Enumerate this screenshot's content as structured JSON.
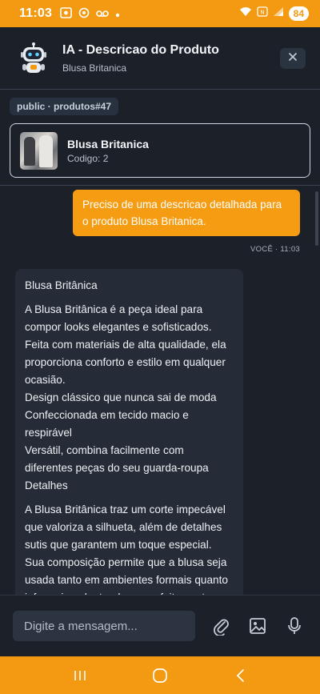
{
  "status_bar": {
    "time": "11:03",
    "battery": "84",
    "left_icons": [
      "screenshot-icon",
      "at-icon",
      "voicemail-icon",
      "dot-icon"
    ],
    "right_icons": [
      "wifi-icon",
      "nfc-icon",
      "signal-icon",
      "battery-icon"
    ]
  },
  "header": {
    "title": "IA - Descricao do Produto",
    "subtitle": "Blusa Britanica",
    "close_icon": "close-icon"
  },
  "tag": "public · produtos#47",
  "product": {
    "name": "Blusa Britanica",
    "code": "Codigo: 2"
  },
  "messages": {
    "user": {
      "text": "Preciso de uma descricao detalhada para o produto Blusa Britanica.",
      "meta": "VOCÊ · 11:03"
    },
    "ai": {
      "title": "Blusa Britânica",
      "lines": [
        "A Blusa Britânica é a peça ideal para compor looks elegantes e sofisticados. Feita com materiais de alta qualidade, ela proporciona conforto e estilo em qualquer ocasião.",
        "Design clássico que nunca sai de moda",
        "Confeccionada em tecido macio e respirável",
        "Versátil, combina facilmente com diferentes peças do seu guarda-roupa",
        "Detalhes"
      ],
      "paragraph2": "A Blusa Britânica traz um corte impecável que valoriza a silhueta, além de detalhes sutis que garantem um toque especial. Sua composição permite que a blusa seja usada tanto em ambientes formais quanto informais, adaptando-se perfeitamente a"
    }
  },
  "composer": {
    "placeholder": "Digite a mensagem...",
    "icons": [
      "attach-icon",
      "image-icon",
      "mic-icon"
    ]
  },
  "nav": [
    "recent-apps-icon",
    "home-icon",
    "back-icon"
  ],
  "colors": {
    "accent": "#f39a12",
    "background": "#1b2029",
    "ai_bubble": "#252c38"
  }
}
